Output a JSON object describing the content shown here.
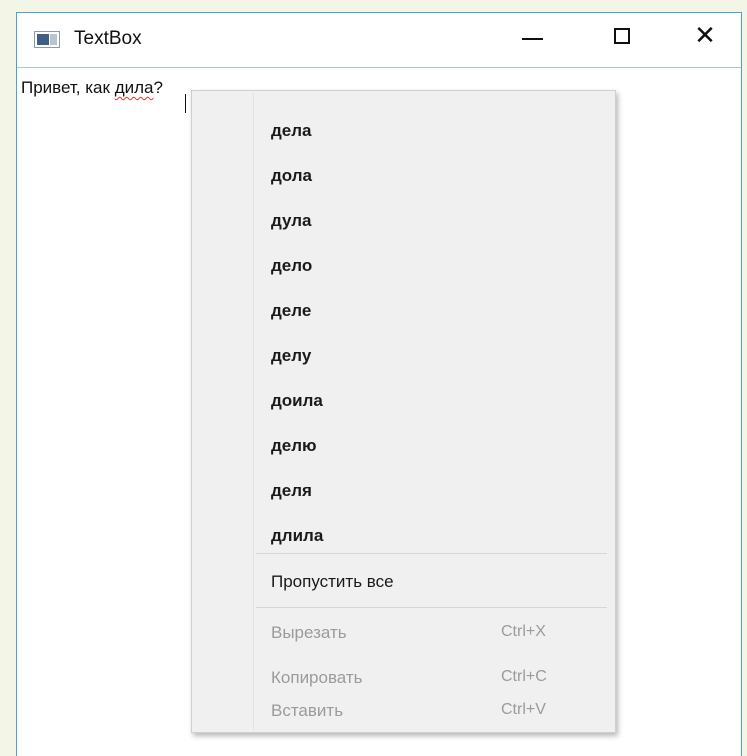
{
  "window": {
    "title": "TextBox",
    "icon": "window-app-icon",
    "minimize_icon": "minimize-icon",
    "maximize_icon": "maximize-icon",
    "close_icon": "close-icon",
    "close_glyph": "✕"
  },
  "textbox": {
    "text_before": "Привет, как ",
    "misspelled_word": "дила",
    "text_after": "?"
  },
  "context_menu": {
    "suggestions": [
      "дела",
      "дола",
      "дула",
      "дело",
      "деле",
      "делу",
      "доила",
      "делю",
      "деля",
      "длила"
    ],
    "ignore_all": "Пропустить все",
    "commands": [
      {
        "label": "Вырезать",
        "shortcut": "Ctrl+X",
        "enabled": false
      },
      {
        "label": "Копировать",
        "shortcut": "Ctrl+C",
        "enabled": false
      },
      {
        "label": "Вставить",
        "shortcut": "Ctrl+V",
        "enabled": false
      }
    ]
  },
  "colors": {
    "window_border": "#4aa0da",
    "spellcheck_underline": "#e0362c",
    "menu_background": "#f0f0f0",
    "disabled_text": "#9b9b9b"
  }
}
